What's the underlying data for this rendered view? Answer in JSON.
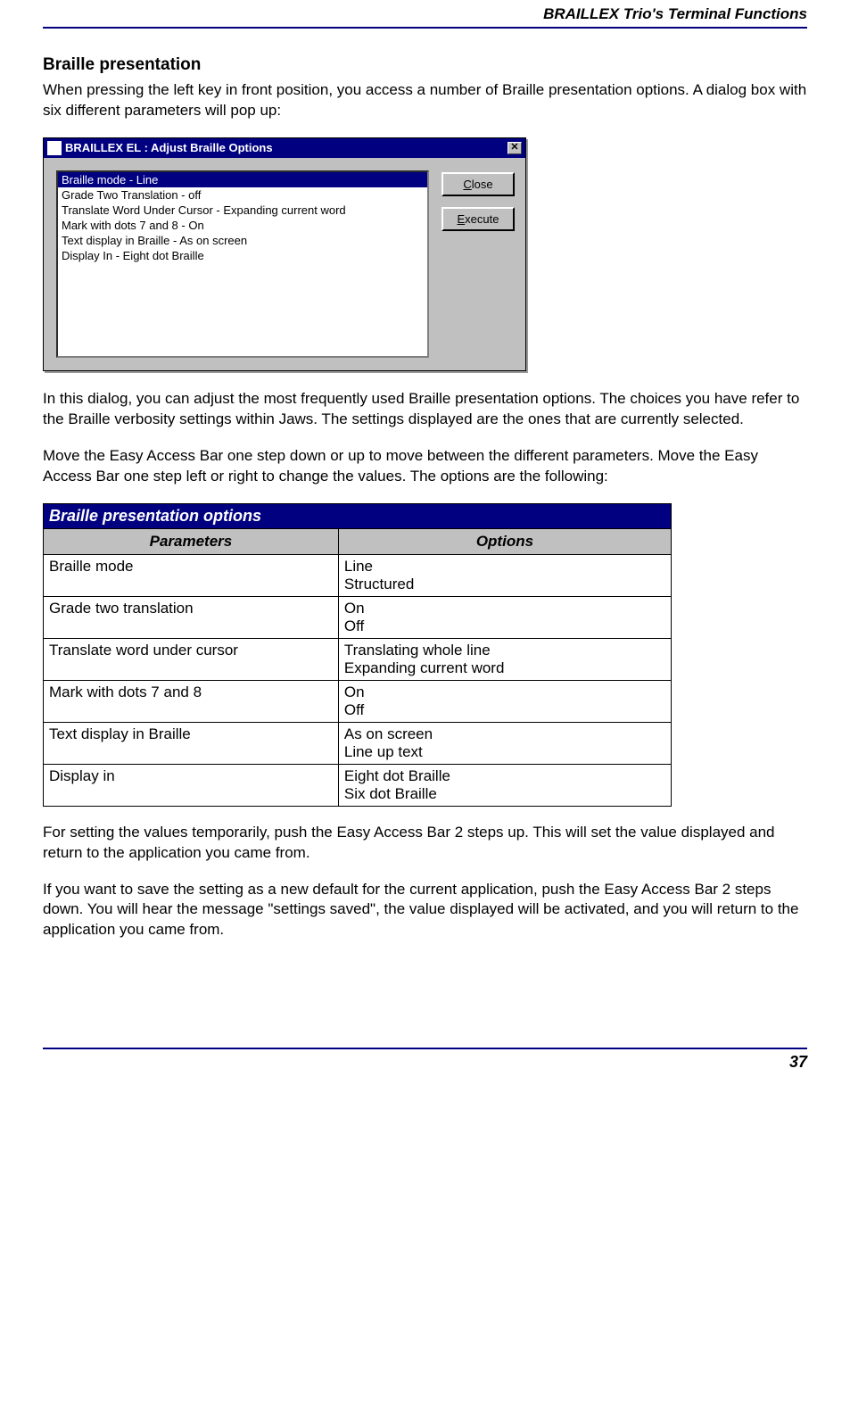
{
  "header": {
    "title": "BRAILLEX Trio's Terminal Functions"
  },
  "section": {
    "heading": "Braille presentation",
    "intro": "When pressing the left key in front position, you access a number of Braille presentation options. A dialog box with six different parameters will pop up:",
    "after_dialog_1": "In this dialog, you can adjust the most frequently used Braille presentation options. The choices you have refer to the Braille verbosity settings within Jaws. The settings displayed are the ones that are currently selected.",
    "after_dialog_2": "Move the Easy Access Bar one step down or up to move between the different parameters. Move the Easy Access Bar one step left or right to change the values. The options are the following:",
    "after_table_1": "For setting the values temporarily, push the Easy Access Bar 2 steps up. This will set the value displayed and return to the application you came from.",
    "after_table_2": "If you want to save the setting as a new default for the current application, push the Easy Access Bar 2 steps down. You will hear the message \"settings saved\", the value displayed will be activated, and you will return to the application you came from."
  },
  "dialog": {
    "title": "BRAILLEX EL : Adjust Braille Options",
    "close_glyph": "✕",
    "items": [
      "Braille mode - Line",
      "Grade Two Translation - off",
      "Translate Word Under Cursor - Expanding current word",
      "Mark with dots 7 and 8 - On",
      "Text display in Braille - As on screen",
      "Display In - Eight dot Braille"
    ],
    "selected_index": 0,
    "buttons": {
      "close_pre": "",
      "close_u": "C",
      "close_post": "lose",
      "exec_pre": "",
      "exec_u": "E",
      "exec_post": "xecute"
    }
  },
  "table": {
    "caption": "Braille presentation options",
    "head_param": "Parameters",
    "head_opt": "Options",
    "rows": [
      {
        "param": "Braille mode",
        "opt1": "Line",
        "opt2": "Structured"
      },
      {
        "param": "Grade two translation",
        "opt1": "On",
        "opt2": "Off"
      },
      {
        "param": "Translate word under cursor",
        "opt1": "Translating whole line",
        "opt2": "Expanding current word"
      },
      {
        "param": "Mark with dots 7 and 8",
        "opt1": "On",
        "opt2": "Off"
      },
      {
        "param": "Text display in Braille",
        "opt1": "As on screen",
        "opt2": "Line up text"
      },
      {
        "param": "Display in",
        "opt1": "Eight dot Braille",
        "opt2": "Six dot Braille"
      }
    ]
  },
  "footer": {
    "page_number": "37"
  }
}
